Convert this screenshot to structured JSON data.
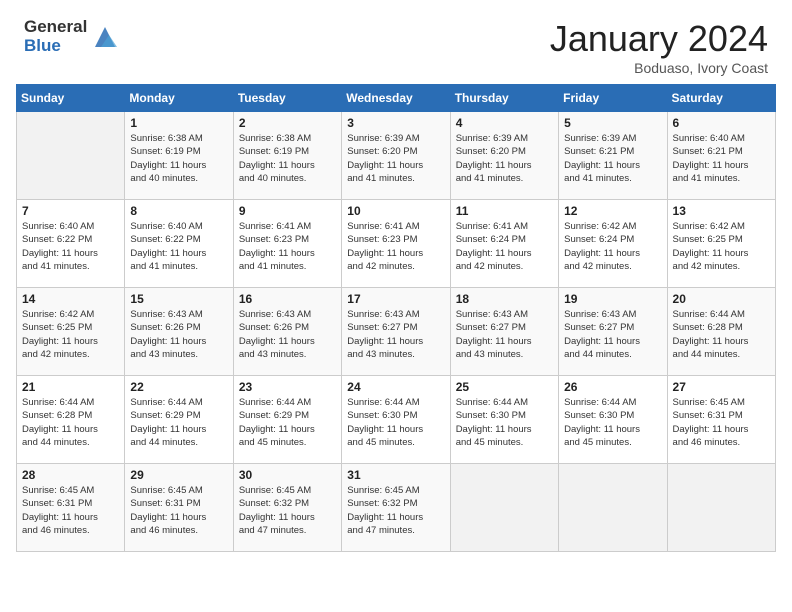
{
  "header": {
    "logo_general": "General",
    "logo_blue": "Blue",
    "month_title": "January 2024",
    "location": "Boduaso, Ivory Coast"
  },
  "weekdays": [
    "Sunday",
    "Monday",
    "Tuesday",
    "Wednesday",
    "Thursday",
    "Friday",
    "Saturday"
  ],
  "weeks": [
    [
      {
        "num": "",
        "info": ""
      },
      {
        "num": "1",
        "info": "Sunrise: 6:38 AM\nSunset: 6:19 PM\nDaylight: 11 hours\nand 40 minutes."
      },
      {
        "num": "2",
        "info": "Sunrise: 6:38 AM\nSunset: 6:19 PM\nDaylight: 11 hours\nand 40 minutes."
      },
      {
        "num": "3",
        "info": "Sunrise: 6:39 AM\nSunset: 6:20 PM\nDaylight: 11 hours\nand 41 minutes."
      },
      {
        "num": "4",
        "info": "Sunrise: 6:39 AM\nSunset: 6:20 PM\nDaylight: 11 hours\nand 41 minutes."
      },
      {
        "num": "5",
        "info": "Sunrise: 6:39 AM\nSunset: 6:21 PM\nDaylight: 11 hours\nand 41 minutes."
      },
      {
        "num": "6",
        "info": "Sunrise: 6:40 AM\nSunset: 6:21 PM\nDaylight: 11 hours\nand 41 minutes."
      }
    ],
    [
      {
        "num": "7",
        "info": "Sunrise: 6:40 AM\nSunset: 6:22 PM\nDaylight: 11 hours\nand 41 minutes."
      },
      {
        "num": "8",
        "info": "Sunrise: 6:40 AM\nSunset: 6:22 PM\nDaylight: 11 hours\nand 41 minutes."
      },
      {
        "num": "9",
        "info": "Sunrise: 6:41 AM\nSunset: 6:23 PM\nDaylight: 11 hours\nand 41 minutes."
      },
      {
        "num": "10",
        "info": "Sunrise: 6:41 AM\nSunset: 6:23 PM\nDaylight: 11 hours\nand 42 minutes."
      },
      {
        "num": "11",
        "info": "Sunrise: 6:41 AM\nSunset: 6:24 PM\nDaylight: 11 hours\nand 42 minutes."
      },
      {
        "num": "12",
        "info": "Sunrise: 6:42 AM\nSunset: 6:24 PM\nDaylight: 11 hours\nand 42 minutes."
      },
      {
        "num": "13",
        "info": "Sunrise: 6:42 AM\nSunset: 6:25 PM\nDaylight: 11 hours\nand 42 minutes."
      }
    ],
    [
      {
        "num": "14",
        "info": "Sunrise: 6:42 AM\nSunset: 6:25 PM\nDaylight: 11 hours\nand 42 minutes."
      },
      {
        "num": "15",
        "info": "Sunrise: 6:43 AM\nSunset: 6:26 PM\nDaylight: 11 hours\nand 43 minutes."
      },
      {
        "num": "16",
        "info": "Sunrise: 6:43 AM\nSunset: 6:26 PM\nDaylight: 11 hours\nand 43 minutes."
      },
      {
        "num": "17",
        "info": "Sunrise: 6:43 AM\nSunset: 6:27 PM\nDaylight: 11 hours\nand 43 minutes."
      },
      {
        "num": "18",
        "info": "Sunrise: 6:43 AM\nSunset: 6:27 PM\nDaylight: 11 hours\nand 43 minutes."
      },
      {
        "num": "19",
        "info": "Sunrise: 6:43 AM\nSunset: 6:27 PM\nDaylight: 11 hours\nand 44 minutes."
      },
      {
        "num": "20",
        "info": "Sunrise: 6:44 AM\nSunset: 6:28 PM\nDaylight: 11 hours\nand 44 minutes."
      }
    ],
    [
      {
        "num": "21",
        "info": "Sunrise: 6:44 AM\nSunset: 6:28 PM\nDaylight: 11 hours\nand 44 minutes."
      },
      {
        "num": "22",
        "info": "Sunrise: 6:44 AM\nSunset: 6:29 PM\nDaylight: 11 hours\nand 44 minutes."
      },
      {
        "num": "23",
        "info": "Sunrise: 6:44 AM\nSunset: 6:29 PM\nDaylight: 11 hours\nand 45 minutes."
      },
      {
        "num": "24",
        "info": "Sunrise: 6:44 AM\nSunset: 6:30 PM\nDaylight: 11 hours\nand 45 minutes."
      },
      {
        "num": "25",
        "info": "Sunrise: 6:44 AM\nSunset: 6:30 PM\nDaylight: 11 hours\nand 45 minutes."
      },
      {
        "num": "26",
        "info": "Sunrise: 6:44 AM\nSunset: 6:30 PM\nDaylight: 11 hours\nand 45 minutes."
      },
      {
        "num": "27",
        "info": "Sunrise: 6:45 AM\nSunset: 6:31 PM\nDaylight: 11 hours\nand 46 minutes."
      }
    ],
    [
      {
        "num": "28",
        "info": "Sunrise: 6:45 AM\nSunset: 6:31 PM\nDaylight: 11 hours\nand 46 minutes."
      },
      {
        "num": "29",
        "info": "Sunrise: 6:45 AM\nSunset: 6:31 PM\nDaylight: 11 hours\nand 46 minutes."
      },
      {
        "num": "30",
        "info": "Sunrise: 6:45 AM\nSunset: 6:32 PM\nDaylight: 11 hours\nand 47 minutes."
      },
      {
        "num": "31",
        "info": "Sunrise: 6:45 AM\nSunset: 6:32 PM\nDaylight: 11 hours\nand 47 minutes."
      },
      {
        "num": "",
        "info": ""
      },
      {
        "num": "",
        "info": ""
      },
      {
        "num": "",
        "info": ""
      }
    ]
  ]
}
